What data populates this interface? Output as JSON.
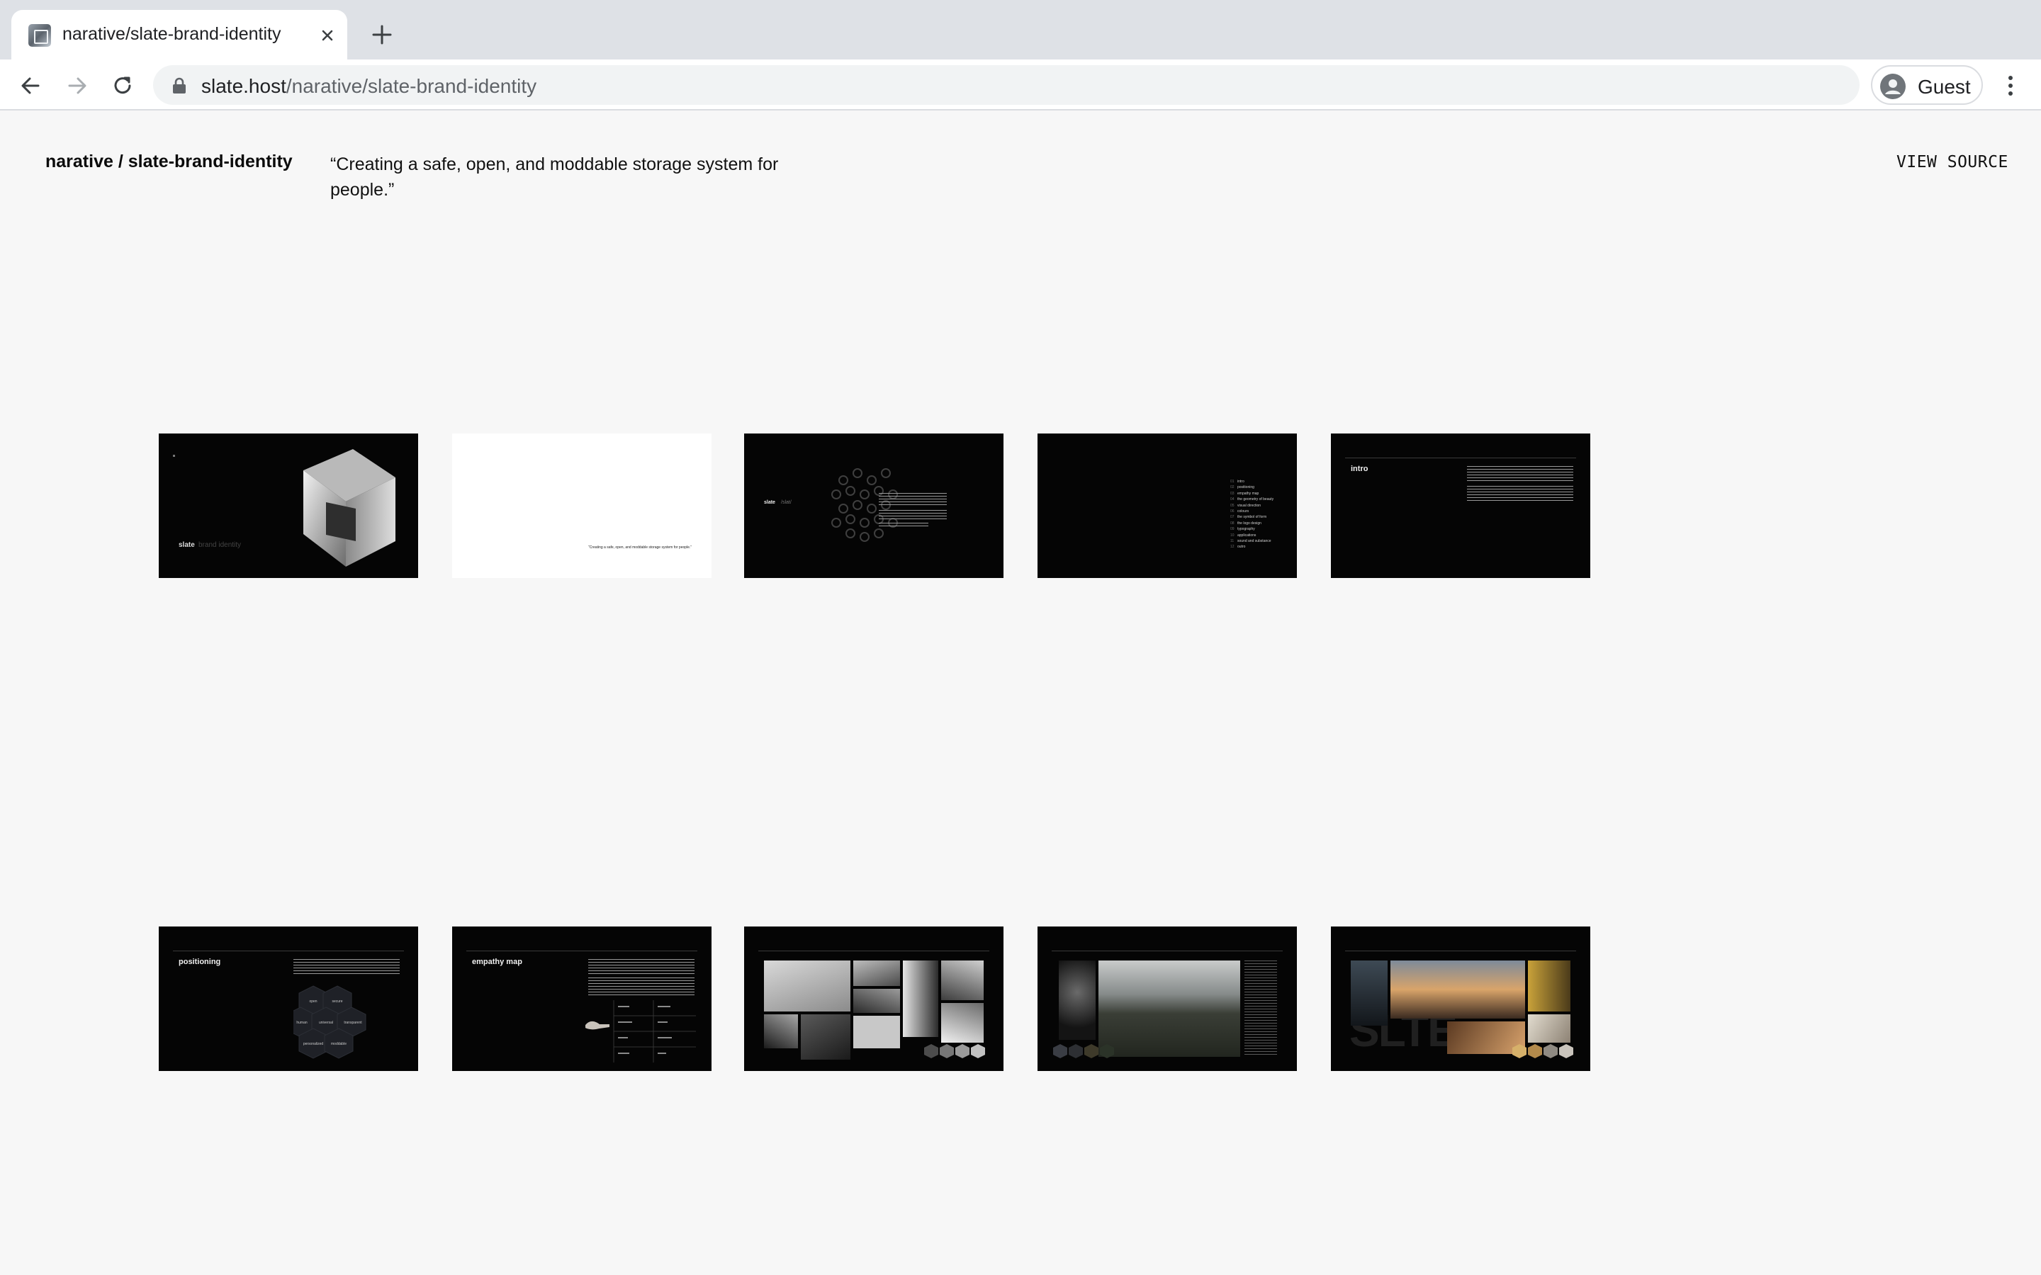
{
  "browser": {
    "tab_title": "narative/slate-brand-identity",
    "url_host": "slate.host",
    "url_path": "/narative/slate-brand-identity",
    "profile_label": "Guest"
  },
  "header": {
    "slug": "narative / slate-brand-identity",
    "quote": "“Creating a safe, open, and moddable storage system for people.”",
    "view_source": "VIEW SOURCE"
  },
  "slides": [
    {
      "brand": "slate",
      "subtitle": "brand identity"
    },
    {
      "caption": "“Creating a safe, open, and moddable storage system for people.”"
    },
    {
      "brand": "slate",
      "subtitle": "/slat/"
    },
    {
      "index": [
        "intro",
        "positioning",
        "empathy map",
        "the geometry of beauty",
        "visual direction",
        "colours",
        "the symbol of form",
        "the logo design",
        "typography",
        "applications",
        "sound and substance",
        "outro"
      ]
    },
    {
      "title": "intro"
    },
    {
      "title": "positioning",
      "hex_labels": [
        "open",
        "secure",
        "human",
        "universal",
        "transparent",
        "personalized",
        "moddable"
      ]
    },
    {
      "title": "empathy map"
    },
    {
      "title": ""
    },
    {
      "title": ""
    },
    {
      "title": "",
      "wordmark": "SLTE"
    }
  ],
  "colors": {
    "page_bg": "#f7f7f7",
    "slide_bg": "#050505",
    "tabstrip_bg": "#dee1e6"
  }
}
